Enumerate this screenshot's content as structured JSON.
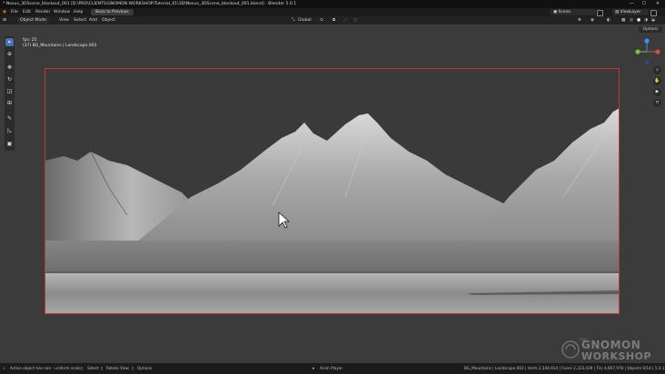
{
  "window": {
    "title": "* Nexus_3DScene_blockout_001 [D:\\PRO\\CLIENTS\\GNOMON WORKSHOP\\Tutorial_01\\3D\\Nexus_3DScene_blockout_001.blend] - Blender 5.0.1",
    "minimize": "—",
    "maximize": "☐",
    "close": "✕"
  },
  "menu": {
    "items": [
      "File",
      "Edit",
      "Render",
      "Window",
      "Help"
    ],
    "back_label": "Back to Previous",
    "scene_label": "Scene",
    "view_layer_label": "ViewLayer"
  },
  "header": {
    "mode": "Object Mode",
    "menus": [
      "View",
      "Select",
      "Add",
      "Object"
    ],
    "orientation": "Global",
    "options_label": "Options"
  },
  "viewport": {
    "fps": "fps: 25",
    "object_info": "(37) BG_Mountains | Landscape.003"
  },
  "status": {
    "hint1": "Active object has non - uniform scale",
    "select": "Select",
    "rotate_view": "Rotate View",
    "options": "Options",
    "anim_player": "Anim Player",
    "stats": "BG_Mountains | Landscape.003 | Verts 2,344,914 | Faces 2,333,439 | Tris 4,667,978 | Objects 0/14 | 5.0.1"
  },
  "watermark": {
    "the": "THE",
    "line1": "GNOMON",
    "line2": "WORKSHOP"
  },
  "colors": {
    "accent": "#4772b3",
    "camera_border": "#c0392b",
    "sky": "#3b3b3b"
  }
}
